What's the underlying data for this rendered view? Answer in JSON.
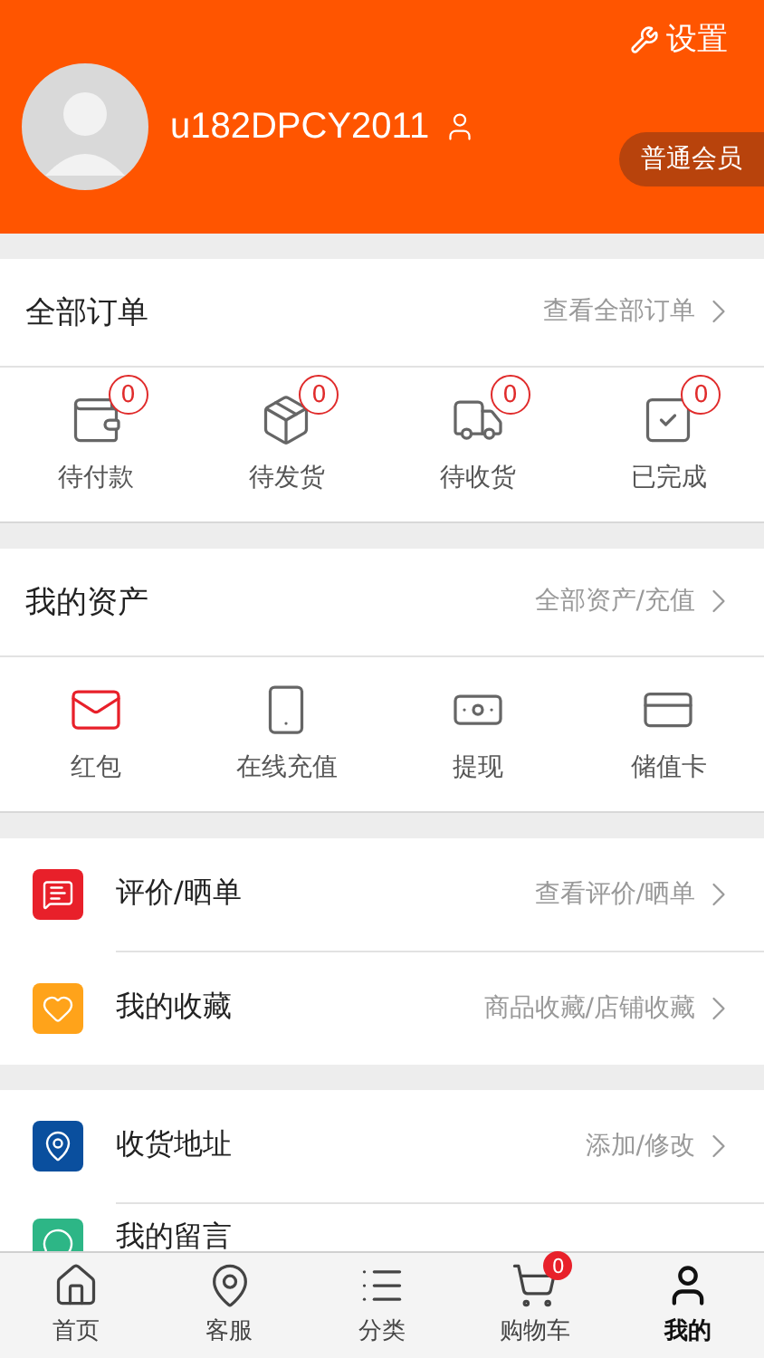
{
  "header": {
    "settings": "设置",
    "username": "u182DPCY2011",
    "member_level": "普通会员"
  },
  "orders": {
    "title": "全部订单",
    "link": "查看全部订单",
    "items": [
      {
        "label": "待付款",
        "count": "0"
      },
      {
        "label": "待发货",
        "count": "0"
      },
      {
        "label": "待收货",
        "count": "0"
      },
      {
        "label": "已完成",
        "count": "0"
      }
    ]
  },
  "assets": {
    "title": "我的资产",
    "link": "全部资产/充值",
    "items": [
      {
        "label": "红包",
        "highlight": true
      },
      {
        "label": "在线充值",
        "highlight": false
      },
      {
        "label": "提现",
        "highlight": false
      },
      {
        "label": "储值卡",
        "highlight": false
      }
    ]
  },
  "menu_groups": [
    [
      {
        "label": "评价/晒单",
        "link": "查看评价/晒单",
        "color": "#e8202a"
      },
      {
        "label": "我的收藏",
        "link": "商品收藏/店铺收藏",
        "color": "#ffa31a"
      }
    ],
    [
      {
        "label": "收货地址",
        "link": "添加/修改",
        "color": "#0a4f9e"
      },
      {
        "label": "我的留言",
        "color": "#2db686"
      }
    ]
  ],
  "tab_bar": [
    {
      "label": "首页",
      "selected": false
    },
    {
      "label": "客服",
      "selected": false
    },
    {
      "label": "分类",
      "selected": false
    },
    {
      "label": "购物车",
      "selected": false,
      "badge": "0"
    },
    {
      "label": "我的",
      "selected": true
    }
  ]
}
